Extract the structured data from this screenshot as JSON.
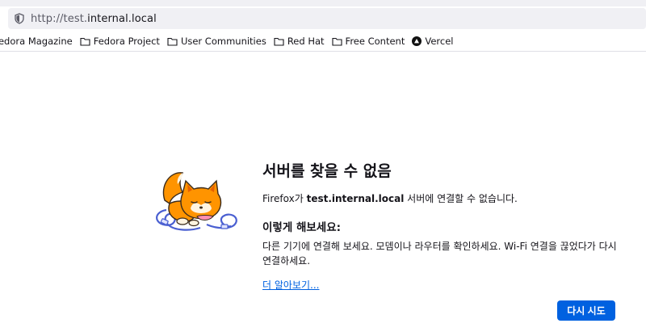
{
  "browser": {
    "url_prefix": "http://test.",
    "url_host": "internal.local",
    "bookmarks": [
      {
        "label": "Fedora Magazine",
        "icon": "none"
      },
      {
        "label": "Fedora Project",
        "icon": "folder-icon"
      },
      {
        "label": "User Communities",
        "icon": "folder-icon"
      },
      {
        "label": "Red Hat",
        "icon": "folder-icon"
      },
      {
        "label": "Free Content",
        "icon": "folder-icon"
      },
      {
        "label": "Vercel",
        "icon": "vercel-icon"
      }
    ]
  },
  "error": {
    "title": "서버를 찾을 수 없음",
    "desc_prefix": "Firefox가 ",
    "desc_host": "test.internal.local",
    "desc_suffix": " 서버에 연결할 수 없습니다.",
    "try_title": "이렇게 해보세요:",
    "try_text": "다른 기기에 연결해 보세요. 모뎀이나 라우터를 확인하세요. Wi-Fi 연결을 끊었다가 다시 연결하세요.",
    "learn_more": "더 알아보기...",
    "retry": "다시 시도"
  },
  "colors": {
    "accent": "#0061e0",
    "fox_orange": "#ff9400",
    "fox_dark_orange": "#e66000",
    "cable_blue": "#4a5fd1"
  }
}
